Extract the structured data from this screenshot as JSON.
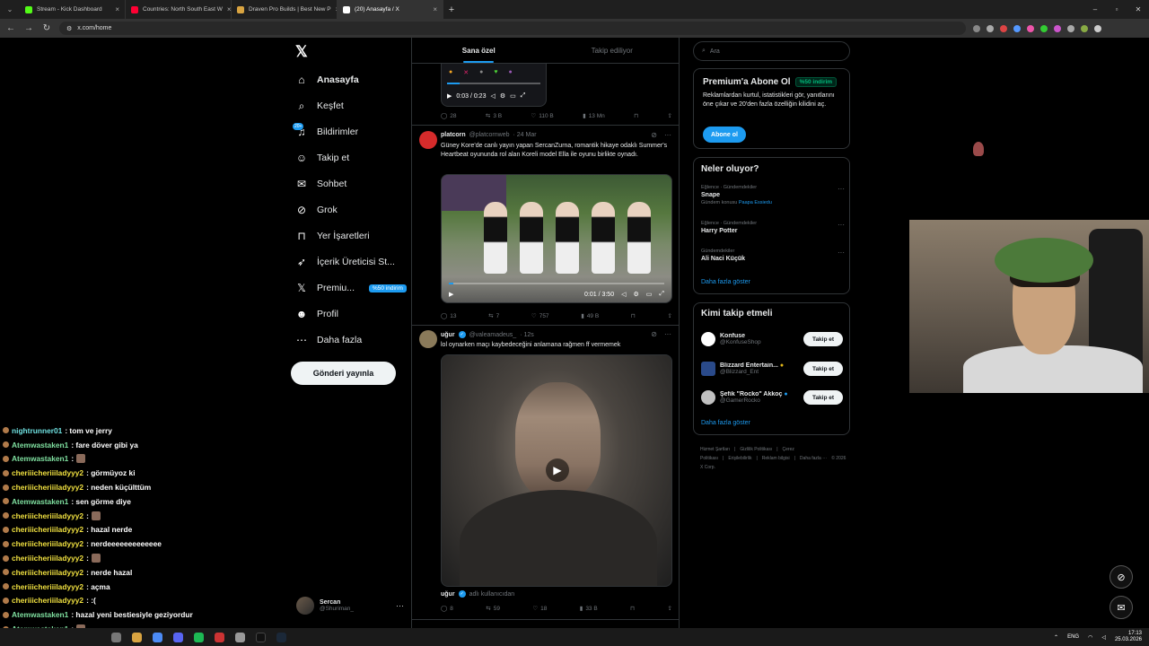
{
  "browser": {
    "tabs": [
      {
        "label": "Stream - Kick Dashboard",
        "color": "#53fc18",
        "active": false
      },
      {
        "label": "Countries: North South East W",
        "color": "#ff0033",
        "active": false
      },
      {
        "label": "Draven Pro Builds | Best New P",
        "color": "#d9a441",
        "active": false
      },
      {
        "label": "(20) Anasayfa / X",
        "color": "#ffffff",
        "active": true
      }
    ],
    "url": "x.com/home"
  },
  "nav": {
    "items": [
      {
        "label": "Anasayfa",
        "icon": "home-icon",
        "glyph": "⌂"
      },
      {
        "label": "Keşfet",
        "icon": "search-icon",
        "glyph": "⌕"
      },
      {
        "label": "Bildirimler",
        "icon": "bell-icon",
        "glyph": "♫"
      },
      {
        "label": "Takip et",
        "icon": "add-user-icon",
        "glyph": "☺"
      },
      {
        "label": "Sohbet",
        "icon": "mail-icon",
        "glyph": "✉"
      },
      {
        "label": "Grok",
        "icon": "grok-icon",
        "glyph": "⊘"
      },
      {
        "label": "Yer İşaretleri",
        "icon": "bookmark-icon",
        "glyph": "⊓"
      },
      {
        "label": "İçerik Üreticisi St...",
        "icon": "rocket-icon",
        "glyph": "➶"
      },
      {
        "label": "Premiu...",
        "icon": "x-logo-icon",
        "glyph": "𝕏"
      },
      {
        "label": "Profil",
        "icon": "profile-icon",
        "glyph": "☻"
      },
      {
        "label": "Daha fazla",
        "icon": "more-icon",
        "glyph": "⋯"
      }
    ],
    "notif_count": "20+",
    "premium_badge": "%50 indirim",
    "post_button": "Gönderi yayınla",
    "profile": {
      "name": "Sercan",
      "handle": "@Shuriman_"
    }
  },
  "feed": {
    "tabs": [
      "Sana özel",
      "Takip ediliyor"
    ],
    "top_media": {
      "time": "0:03 / 0:23"
    },
    "top_actions": {
      "replies": "28",
      "reposts": "3 B",
      "likes": "110 B",
      "views": "13 Mn"
    },
    "post1": {
      "name": "platcorn",
      "handle": "@platcornweb",
      "time": "· 24 Mar",
      "text": "Güney Kore'de canlı yayın yapan SercanZurna, romantik hikaye odaklı Summer's Heartbeat oyununda rol alan Koreli model Ella ile oyunu birlikte oynadı.",
      "video_time": "0:01 / 3:50",
      "progress": 0.02,
      "actions": {
        "replies": "13",
        "reposts": "7",
        "likes": "757",
        "views": "49 B"
      }
    },
    "post2": {
      "name": "uğur",
      "handle": "@valeamadeus_",
      "time": "· 12s",
      "text": "lol oynarken maçı kaybedeceğini anlamana rağmen ff vermemek",
      "footer_name": "uğur",
      "footer_handle": "adlı kullanıcıdan",
      "actions": {
        "replies": "8",
        "reposts": "59",
        "likes": "18",
        "views": "33 B"
      }
    }
  },
  "right": {
    "search_placeholder": "Ara",
    "premium": {
      "title": "Premium'a Abone Ol",
      "badge": "%50 indirim",
      "desc": "Reklamlardan kurtul, istatistikleri gör, yanıtlarını öne çıkar ve 20'den fazla özelliğin kilidini aç.",
      "button": "Abone ol"
    },
    "trends_title": "Neler oluyor?",
    "trends": [
      {
        "category": "Eğlence · Gündemdekiler",
        "title": "Snape",
        "context": "Gündem konusu",
        "context_link": "Paapa Essiedu"
      },
      {
        "category": "Eğlence · Gündemdekiler",
        "title": "Harry Potter",
        "context": "",
        "context_link": ""
      },
      {
        "category": "Gündemdekiler",
        "title": "Ali Naci Küçük",
        "context": "",
        "context_link": ""
      }
    ],
    "show_more": "Daha fazla göster",
    "follow_title": "Kimi takip etmeli",
    "follow": [
      {
        "name": "Konfuse",
        "handle": "@KonfuseShop",
        "color": "#ffffff"
      },
      {
        "name": "Blizzard Entertain...",
        "handle": "@Blizzard_Ent",
        "color": "#2a4a8a"
      },
      {
        "name": "Şefik \"Rocko\" Akkoç",
        "handle": "@GamerRocko",
        "color": "#c0c0c0"
      }
    ],
    "follow_button": "Takip et",
    "footer": [
      "Hizmet Şartları",
      "|",
      "Gizlilik Politikası",
      "|",
      "Çerez Politikası",
      "|",
      "Erişilebilirlik",
      "|",
      "Reklam bilgisi",
      "|",
      "Daha fazla ···",
      "© 2026 X Corp."
    ]
  },
  "chat": [
    {
      "user": "nightrunner01",
      "color": "c",
      "msg": ": tom ve jerry"
    },
    {
      "user": "Atemwastaken1",
      "color": "g",
      "msg": ": fare döver gibi ya"
    },
    {
      "user": "Atemwastaken1",
      "color": "g",
      "msg": ":"
    },
    {
      "user": "cheriiicheriiiladyyy2",
      "color": "y",
      "msg": ": görmüyoz ki"
    },
    {
      "user": "cheriiicheriiiladyyy2",
      "color": "y",
      "msg": ": neden küçülttüm"
    },
    {
      "user": "Atemwastaken1",
      "color": "g",
      "msg": ": sen görme diye"
    },
    {
      "user": "cheriiicheriiiladyyy2",
      "color": "y",
      "msg": ":"
    },
    {
      "user": "cheriiicheriiiladyyy2",
      "color": "y",
      "msg": ": hazal nerde"
    },
    {
      "user": "cheriiicheriiiladyyy2",
      "color": "y",
      "msg": ": nerdeeeeeeeeeeeee"
    },
    {
      "user": "cheriiicheriiiladyyy2",
      "color": "y",
      "msg": ":"
    },
    {
      "user": "cheriiicheriiiladyyy2",
      "color": "y",
      "msg": ": nerde hazal"
    },
    {
      "user": "cheriiicheriiiladyyy2",
      "color": "y",
      "msg": ": açma"
    },
    {
      "user": "cheriiicheriiiladyyy2",
      "color": "y",
      "msg": ": :("
    },
    {
      "user": "Atemwastaken1",
      "color": "g",
      "msg": ": hazal yeni bestiesiyle geziyordur"
    },
    {
      "user": "Atemwastaken1",
      "color": "g",
      "msg": ":"
    }
  ],
  "taskbar": {
    "lang": "ENG",
    "time": "17:13",
    "date": "25.03.2026"
  }
}
